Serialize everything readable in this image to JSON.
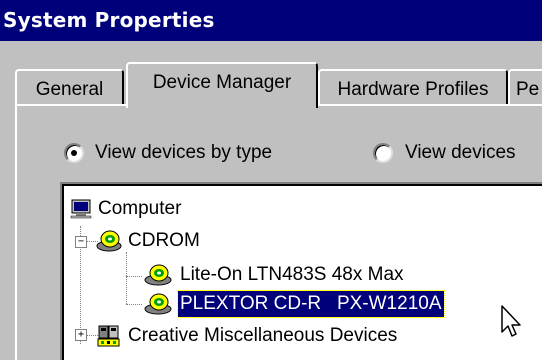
{
  "window": {
    "title": "System Properties"
  },
  "tabs": [
    {
      "label": "General",
      "active": false
    },
    {
      "label": "Device Manager",
      "active": true
    },
    {
      "label": "Hardware Profiles",
      "active": false
    },
    {
      "label": "Pe",
      "active": false
    }
  ],
  "view_options": [
    {
      "label": "View devices by type",
      "selected": true
    },
    {
      "label": "View devices",
      "selected": false
    }
  ],
  "tree": {
    "items": [
      {
        "label": "Computer",
        "icon": "computer-icon",
        "level": 0,
        "expander": ""
      },
      {
        "label": "CDROM",
        "icon": "cdrom-icon",
        "level": 1,
        "expander": "−"
      },
      {
        "label": "Lite-On LTN483S 48x Max",
        "icon": "cdrom-drive-icon",
        "level": 2,
        "expander": ""
      },
      {
        "label": "PLEXTOR CD-R   PX-W1210A",
        "icon": "cdrom-drive-icon",
        "level": 2,
        "expander": "",
        "selected": true
      },
      {
        "label": "Creative Miscellaneous Devices",
        "icon": "devices-icon",
        "level": 1,
        "expander": "+"
      }
    ]
  },
  "colors": {
    "title_bg": "#00007b",
    "selection_bg": "#00007b",
    "face": "#c0c0c0"
  }
}
